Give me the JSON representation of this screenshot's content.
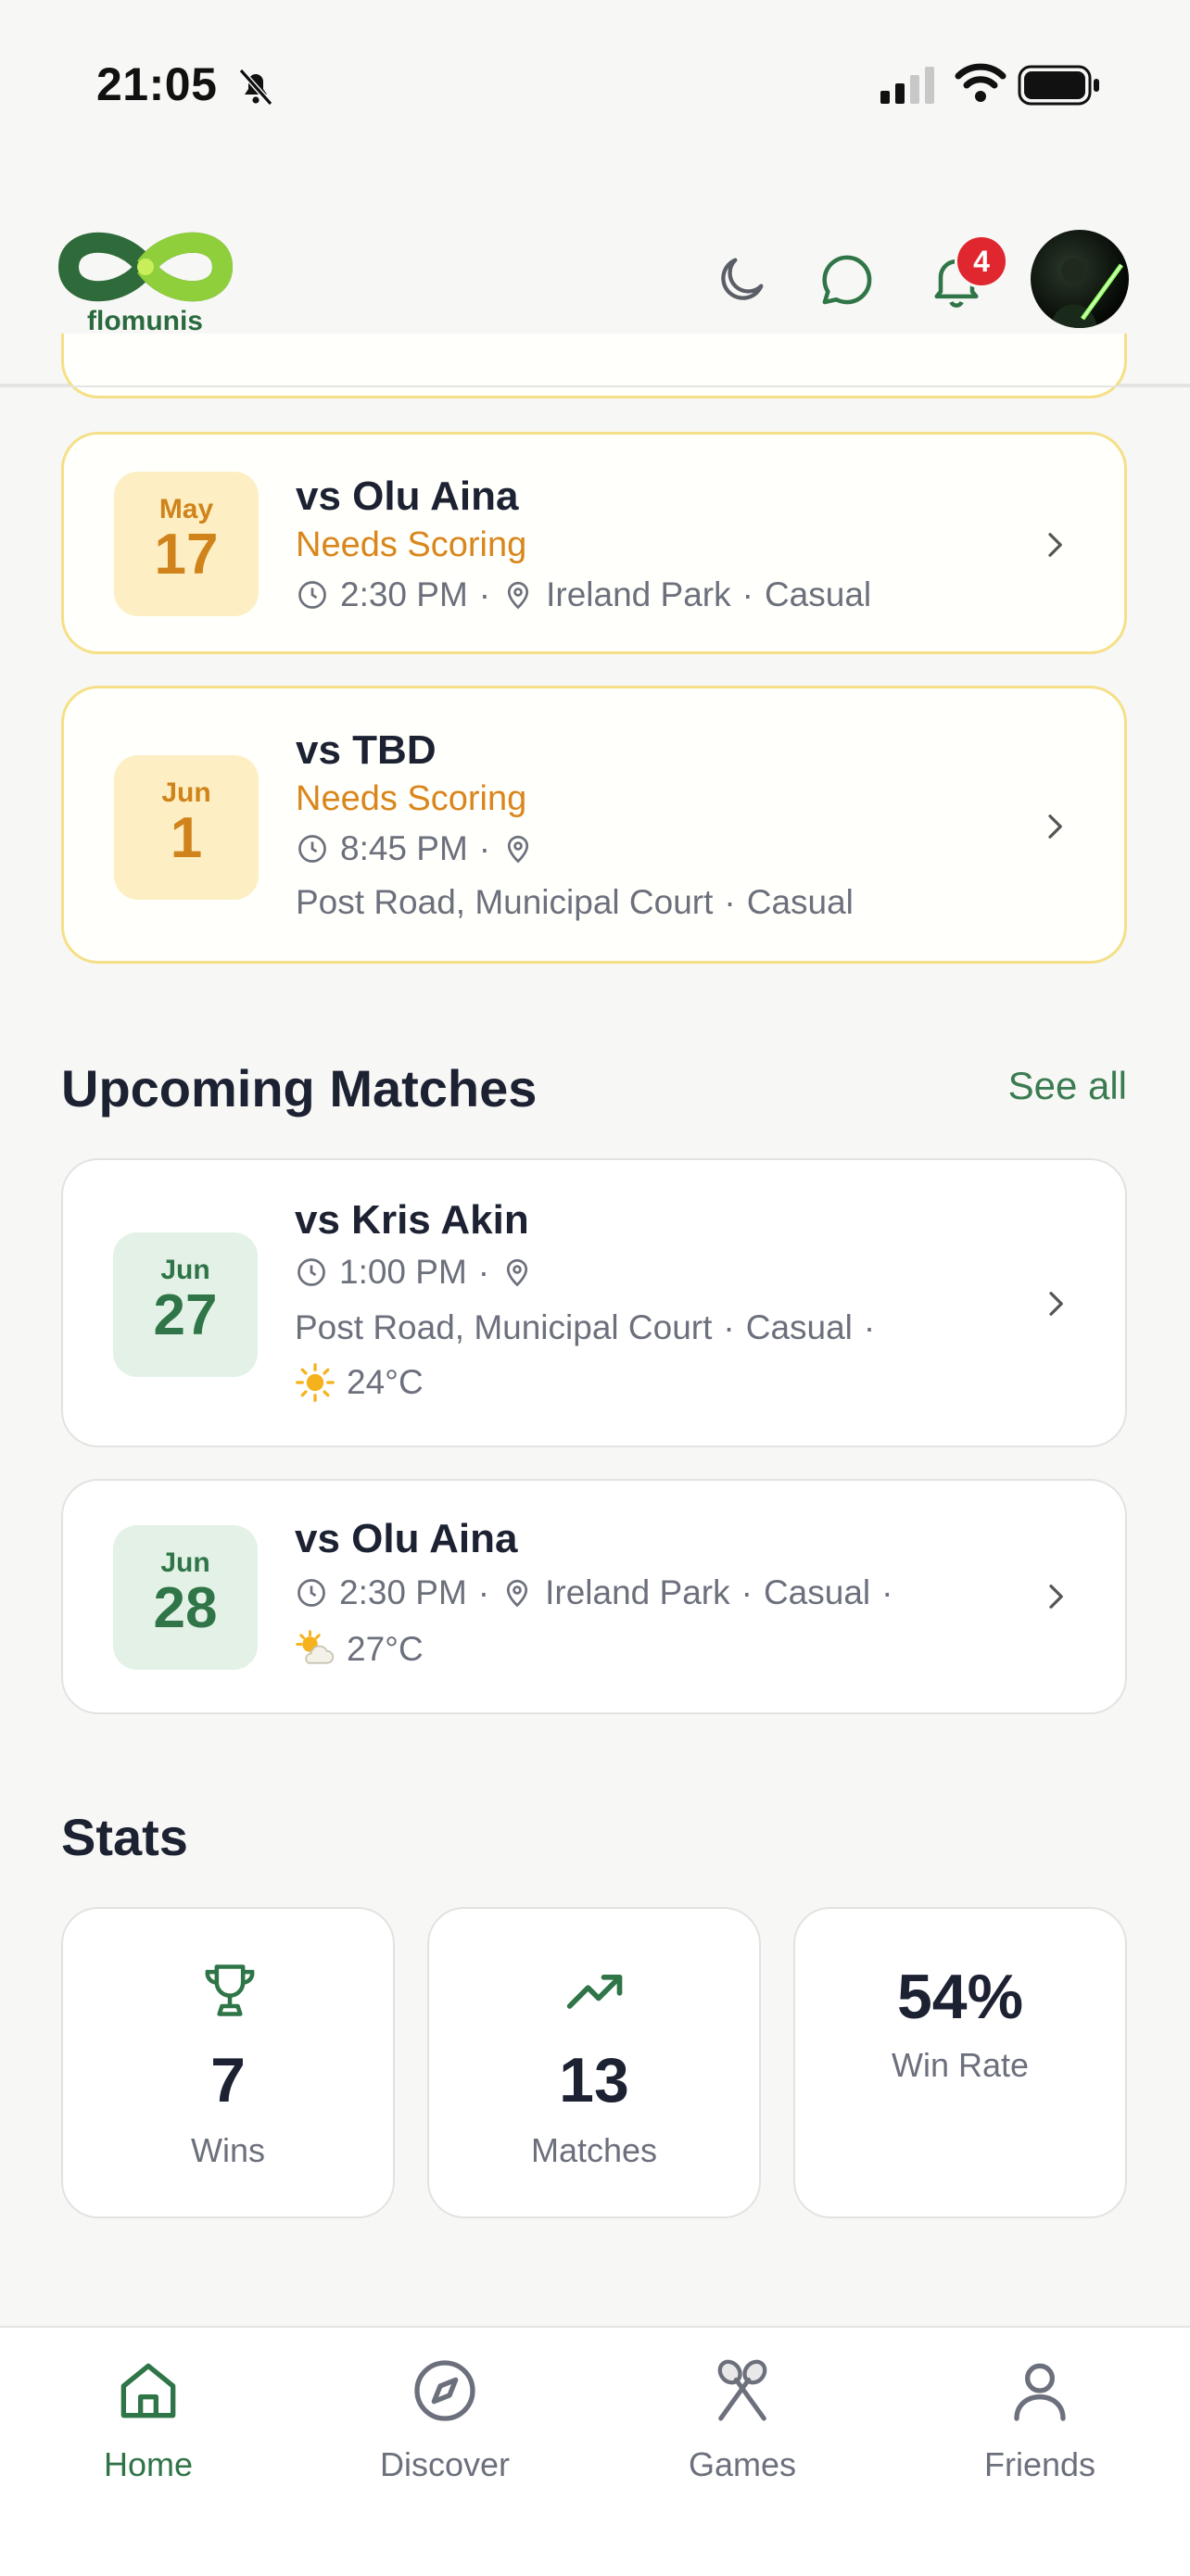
{
  "status_bar": {
    "time": "21:05"
  },
  "header": {
    "app_name": "flomunis",
    "notification_count": "4"
  },
  "needs_scoring": [
    {
      "month": "May",
      "day": "17",
      "opponent": "vs Olu Aina",
      "status": "Needs Scoring",
      "time": "2:30 PM",
      "location": "Ireland Park",
      "type": "Casual"
    },
    {
      "month": "Jun",
      "day": "1",
      "opponent": "vs TBD",
      "status": "Needs Scoring",
      "time": "8:45 PM",
      "location": "Post Road, Municipal Court",
      "type": "Casual"
    }
  ],
  "upcoming": {
    "title": "Upcoming Matches",
    "see_all": "See all",
    "matches": [
      {
        "month": "Jun",
        "day": "27",
        "opponent": "vs Kris Akin",
        "time": "1:00 PM",
        "location": "Post Road, Municipal Court",
        "type": "Casual",
        "temp": "24°C",
        "weather_icon": "sun-icon"
      },
      {
        "month": "Jun",
        "day": "28",
        "opponent": "vs Olu Aina",
        "time": "2:30 PM",
        "location": "Ireland Park",
        "type": "Casual",
        "temp": "27°C",
        "weather_icon": "sun-cloud-icon"
      }
    ]
  },
  "stats": {
    "title": "Stats",
    "wins_value": "7",
    "wins_label": "Wins",
    "matches_value": "13",
    "matches_label": "Matches",
    "winrate_value": "54%",
    "winrate_label": "Win Rate"
  },
  "tabs": [
    {
      "label": "Home",
      "icon": "home-icon",
      "active": true
    },
    {
      "label": "Discover",
      "icon": "compass-icon",
      "active": false
    },
    {
      "label": "Games",
      "icon": "rackets-icon",
      "active": false
    },
    {
      "label": "Friends",
      "icon": "person-icon",
      "active": false
    }
  ],
  "colors": {
    "accent_green": "#2f7547",
    "needs_orange": "#d9861c",
    "badge_red": "#e0262f"
  }
}
